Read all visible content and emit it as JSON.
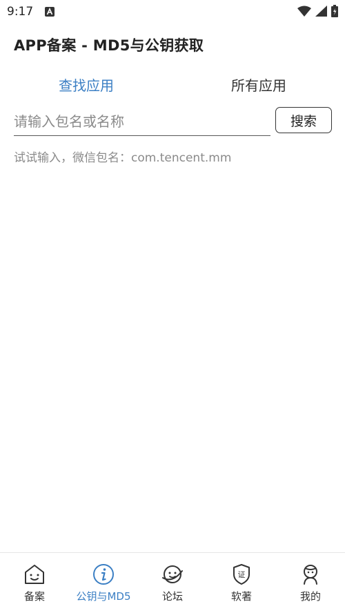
{
  "status_bar": {
    "time": "9:17",
    "notification_icon": "a-icon",
    "wifi_icon": "wifi-icon",
    "signal_icon": "signal-icon",
    "battery_icon": "battery-icon"
  },
  "header": {
    "title": "APP备案 - MD5与公钥获取"
  },
  "tabs": [
    {
      "label": "查找应用",
      "active": true
    },
    {
      "label": "所有应用",
      "active": false
    }
  ],
  "search": {
    "placeholder": "请输入包名或名称",
    "value": "",
    "button_label": "搜索",
    "hint": "试试输入，微信包名：com.tencent.mm"
  },
  "bottom_nav": {
    "items": [
      {
        "label": "备案",
        "icon": "house-face-icon",
        "active": false
      },
      {
        "label": "公钥与MD5",
        "icon": "info-circle-icon",
        "active": true
      },
      {
        "label": "论坛",
        "icon": "planet-face-icon",
        "active": false
      },
      {
        "label": "软著",
        "icon": "certificate-shield-icon",
        "active": false
      },
      {
        "label": "我的",
        "icon": "person-icon",
        "active": false
      }
    ]
  },
  "colors": {
    "accent": "#3b7fc4",
    "text": "#222222",
    "hint": "#8a8a8a"
  }
}
